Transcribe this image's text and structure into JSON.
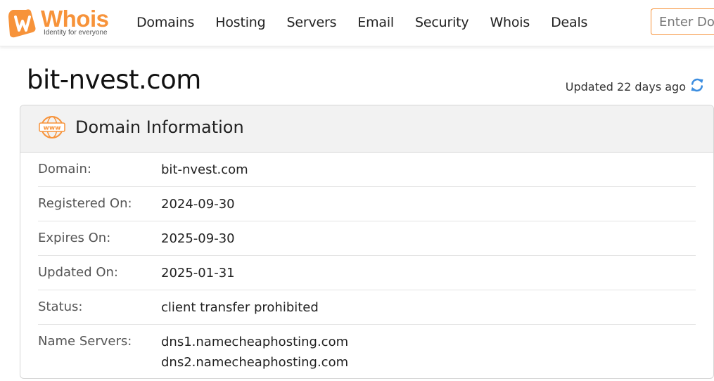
{
  "brand": {
    "name": "Whois",
    "tagline": "Identity for everyone",
    "accent": "#f7933a"
  },
  "nav": [
    "Domains",
    "Hosting",
    "Servers",
    "Email",
    "Security",
    "Whois",
    "Deals"
  ],
  "search": {
    "placeholder": "Enter Domain"
  },
  "page": {
    "title": "bit-nvest.com",
    "updated": "Updated 22 days ago"
  },
  "card": {
    "title": "Domain Information",
    "icon": "www-icon",
    "rows": [
      {
        "label": "Domain:",
        "values": [
          "bit-nvest.com"
        ]
      },
      {
        "label": "Registered On:",
        "values": [
          "2024-09-30"
        ]
      },
      {
        "label": "Expires On:",
        "values": [
          "2025-09-30"
        ]
      },
      {
        "label": "Updated On:",
        "values": [
          "2025-01-31"
        ]
      },
      {
        "label": "Status:",
        "values": [
          "client transfer prohibited"
        ]
      },
      {
        "label": "Name Servers:",
        "values": [
          "dns1.namecheaphosting.com",
          "dns2.namecheaphosting.com"
        ]
      }
    ]
  }
}
